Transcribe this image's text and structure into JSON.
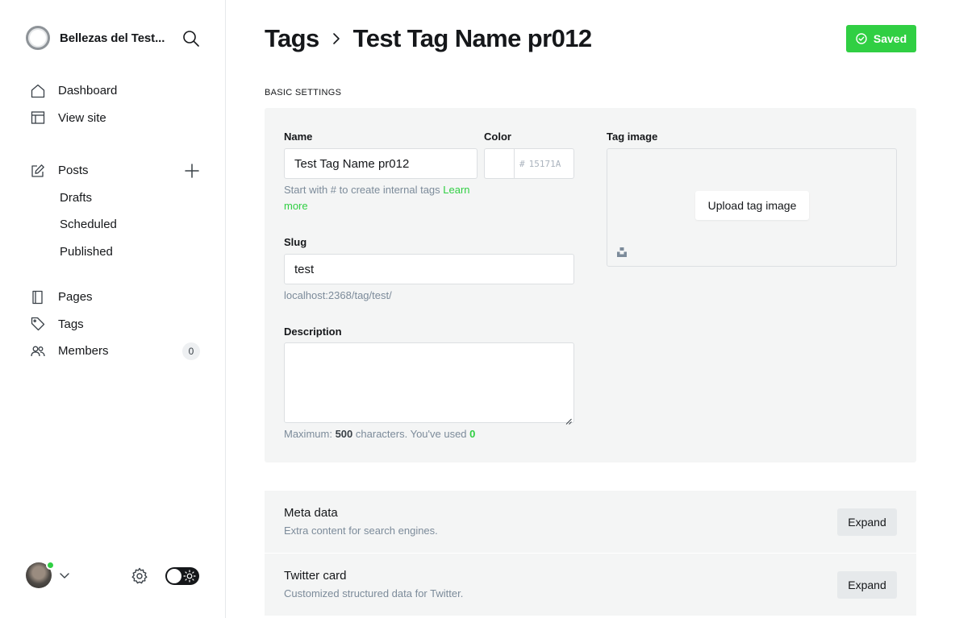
{
  "sidebar": {
    "site_name": "Bellezas del Test...",
    "nav": [
      {
        "label": "Dashboard",
        "icon": "home-icon"
      },
      {
        "label": "View site",
        "icon": "layout-icon"
      }
    ],
    "posts": {
      "label": "Posts",
      "sub_items": [
        "Drafts",
        "Scheduled",
        "Published"
      ]
    },
    "nav2": [
      {
        "label": "Pages",
        "icon": "page-icon"
      },
      {
        "label": "Tags",
        "icon": "tag-icon"
      },
      {
        "label": "Members",
        "icon": "members-icon",
        "count": "0"
      }
    ]
  },
  "header": {
    "breadcrumb_root": "Tags",
    "title": "Test Tag Name pr012",
    "saved_label": "Saved"
  },
  "basic_settings": {
    "section_label": "Basic settings",
    "name_label": "Name",
    "name_value": "Test Tag Name pr012",
    "name_hint": "Start with # to create internal tags",
    "name_hint_link_1": "Learn",
    "name_hint_link_2": "more",
    "color_label": "Color",
    "color_hash": "#",
    "color_value": "15171A",
    "slug_label": "Slug",
    "slug_value": "test",
    "slug_url": "localhost:2368/tag/test/",
    "description_label": "Description",
    "description_value": "",
    "char_hint_prefix": "Maximum:",
    "char_max": "500",
    "char_hint_middle": "characters. You've used",
    "char_used": "0",
    "tag_image_label": "Tag image",
    "upload_label": "Upload tag image"
  },
  "expanders": [
    {
      "title": "Meta data",
      "description": "Extra content for search engines.",
      "button": "Expand"
    },
    {
      "title": "Twitter card",
      "description": "Customized structured data for Twitter.",
      "button": "Expand"
    }
  ],
  "colors": {
    "accent": "#30cf43",
    "text": "#15171a",
    "muted": "#7c8b9a",
    "panel": "#f4f5f5"
  }
}
